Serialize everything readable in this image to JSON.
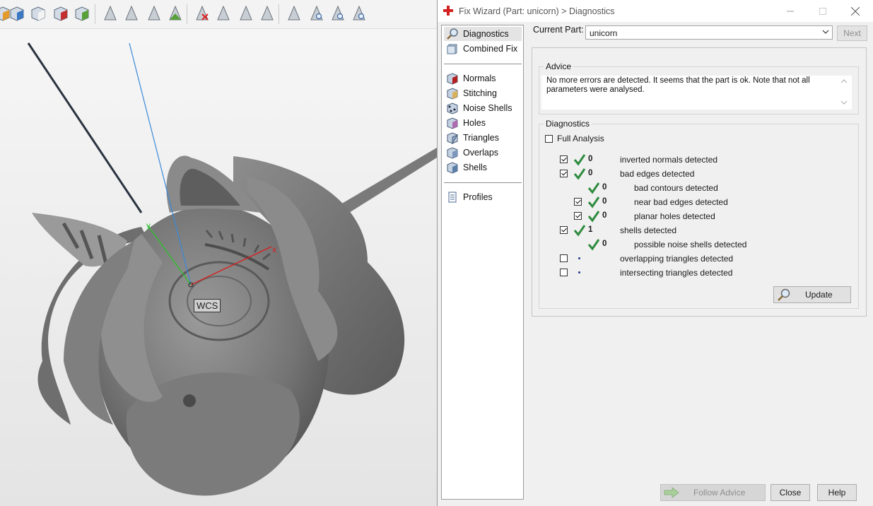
{
  "viewport": {
    "wcs_label": "WCS",
    "axis_x_label": "x",
    "axis_y_label": "y",
    "toolbar_icons": [
      "cube-orange-icon",
      "cube-blue-icon",
      "cube-outline-icon",
      "cube-red-icon",
      "cube-green-icon",
      "triangle-icon",
      "triangle-icon",
      "triangle-icon",
      "triangle-green-icon",
      "triangle-delete-icon",
      "triangle-icon",
      "triangle-icon",
      "triangle-icon",
      "triangle-icon",
      "triangle-search-icon",
      "triangle-view-icon",
      "triangle-view-icon"
    ]
  },
  "dialog": {
    "title": "Fix Wizard (Part: unicorn) > Diagnostics",
    "nav": {
      "items": [
        {
          "label": "Diagnostics",
          "icon": "magnifier-icon",
          "selected": true
        },
        {
          "label": "Combined Fix",
          "icon": "cube-stack-icon"
        },
        {
          "label": "Normals",
          "icon": "normals-cube-icon"
        },
        {
          "label": "Stitching",
          "icon": "stitching-icon"
        },
        {
          "label": "Noise Shells",
          "icon": "noise-shells-icon"
        },
        {
          "label": "Holes",
          "icon": "holes-icon"
        },
        {
          "label": "Triangles",
          "icon": "triangles-icon"
        },
        {
          "label": "Overlaps",
          "icon": "overlaps-icon"
        },
        {
          "label": "Shells",
          "icon": "shells-icon"
        },
        {
          "label": "Profiles",
          "icon": "profiles-doc-icon"
        }
      ]
    },
    "current_part_label": "Current Part:",
    "current_part_value": "unicorn",
    "next_label": "Next",
    "advice": {
      "title": "Advice",
      "text": "No more errors are detected. It seems that the part is ok. Note that not all parameters were analysed."
    },
    "diagnostics": {
      "title": "Diagnostics",
      "full_analysis_label": "Full Analysis",
      "full_analysis_checked": false,
      "rows": [
        {
          "checked": true,
          "status": "ok",
          "count": "0",
          "label": "inverted normals detected",
          "level": 0
        },
        {
          "checked": true,
          "status": "ok",
          "count": "0",
          "label": "bad edges detected",
          "level": 0
        },
        {
          "checked": null,
          "status": "ok",
          "count": "0",
          "label": "bad contours detected",
          "level": 1
        },
        {
          "checked": true,
          "status": "ok",
          "count": "0",
          "label": "near bad edges detected",
          "level": 1
        },
        {
          "checked": true,
          "status": "ok",
          "count": "0",
          "label": "planar holes detected",
          "level": 1
        },
        {
          "checked": true,
          "status": "ok",
          "count": "1",
          "label": "shells detected",
          "level": 0
        },
        {
          "checked": null,
          "status": "ok",
          "count": "0",
          "label": "possible noise shells detected",
          "level": 1
        },
        {
          "checked": false,
          "status": "none",
          "count": "",
          "label": "overlapping triangles detected",
          "level": 0
        },
        {
          "checked": false,
          "status": "none",
          "count": "",
          "label": "intersecting triangles detected",
          "level": 0
        }
      ],
      "update_label": "Update"
    },
    "buttons": {
      "follow_advice": "Follow Advice",
      "close": "Close",
      "help": "Help"
    }
  },
  "colors": {
    "check_green": "#2e8b3e",
    "title_icon_red": "#d21f1f",
    "axis_x": "#cc2222",
    "axis_y": "#33bb33",
    "axis_z": "#3366ff"
  }
}
